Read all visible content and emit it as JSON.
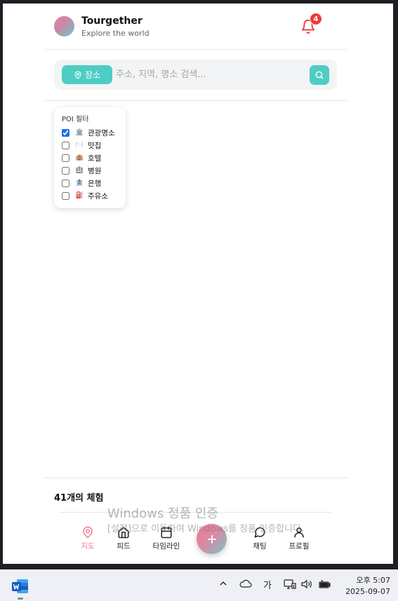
{
  "header": {
    "title": "Tourgether",
    "subtitle": "Explore the world",
    "notification_count": "4"
  },
  "search": {
    "place_button_label": "장소",
    "placeholder": "주소, 지역, 명소 검색..."
  },
  "poi_filter": {
    "title": "POI 필터",
    "items": [
      {
        "label": "관광명소",
        "checked": true,
        "icon": "landmark-icon",
        "emoji": "🏛️"
      },
      {
        "label": "맛집",
        "checked": false,
        "icon": "restaurant-icon",
        "emoji": "🍽️"
      },
      {
        "label": "호텔",
        "checked": false,
        "icon": "hotel-icon",
        "emoji": "🏨"
      },
      {
        "label": "병원",
        "checked": false,
        "icon": "hospital-icon",
        "emoji": "🏥"
      },
      {
        "label": "은행",
        "checked": false,
        "icon": "bank-icon",
        "emoji": "🏦"
      },
      {
        "label": "주유소",
        "checked": false,
        "icon": "gas-station-icon",
        "emoji": "⛽"
      }
    ]
  },
  "experiences": {
    "count_label": "41개의 체험"
  },
  "nav": {
    "items": [
      {
        "label": "지도",
        "icon": "map-pin-icon",
        "active": true
      },
      {
        "label": "피드",
        "icon": "home-icon",
        "active": false
      },
      {
        "label": "타임라인",
        "icon": "calendar-icon",
        "active": false
      },
      {
        "label": "채팅",
        "icon": "chat-icon",
        "active": false
      },
      {
        "label": "프로필",
        "icon": "user-icon",
        "active": false
      }
    ],
    "fab_icon": "plus-icon"
  },
  "watermark": {
    "title": "Windows 정품 인증",
    "subtitle": "[설정]으로 이동하여 Windows를 정품 인증합니다."
  },
  "taskbar": {
    "ime": "가",
    "time": "오후 5:07",
    "date": "2025-09-07"
  },
  "colors": {
    "accent": "#4ecdc4",
    "brand_pink": "#f07a95",
    "badge": "#ef3b3b"
  }
}
